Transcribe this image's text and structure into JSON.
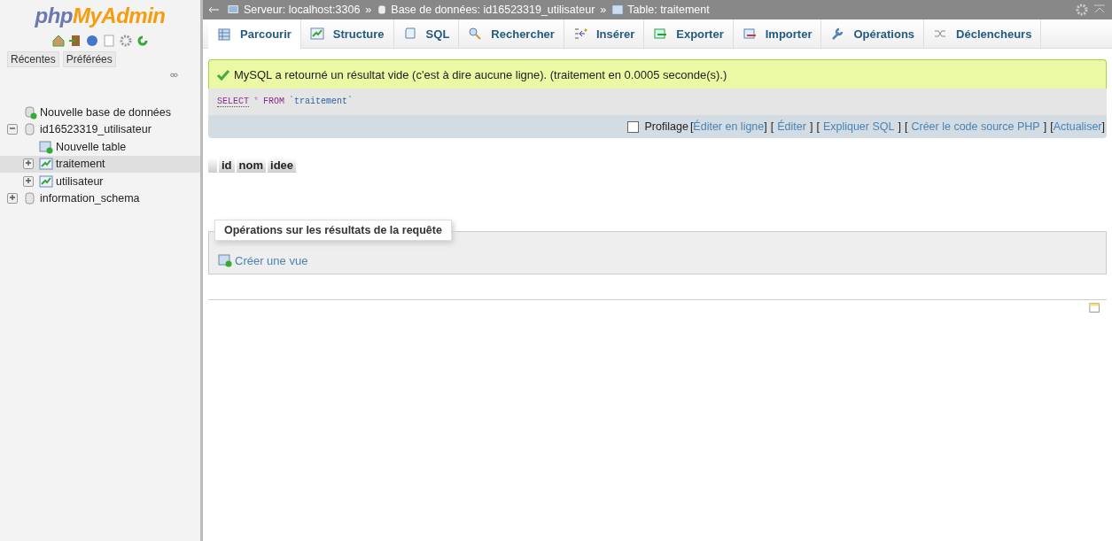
{
  "logo": {
    "part_1": "php",
    "part_2": "MyAdmin"
  },
  "sidebar": {
    "quick_tabs": [
      "Récentes",
      "Préférées"
    ],
    "tree": [
      {
        "kind": "new_db",
        "label": "Nouvelle base de données",
        "selected": false
      },
      {
        "kind": "database",
        "label": "id16523319_utilisateur",
        "expanded": true,
        "selected": false,
        "children": [
          {
            "kind": "new_table",
            "label": "Nouvelle table",
            "selected": false
          },
          {
            "kind": "table",
            "label": "traitement",
            "expanded": false,
            "selected": true
          },
          {
            "kind": "table",
            "label": "utilisateur",
            "expanded": false,
            "selected": false
          }
        ]
      },
      {
        "kind": "database",
        "label": "information_schema",
        "expanded": false,
        "selected": false
      }
    ]
  },
  "breadcrumb": [
    {
      "kind": "server",
      "label": "Serveur: localhost:3306",
      "separator": "»"
    },
    {
      "kind": "database",
      "label": "Base de données: id16523319_utilisateur",
      "separator": "»"
    },
    {
      "kind": "table",
      "label": "Table: traitement"
    }
  ],
  "tabs": [
    {
      "kind": "browse",
      "label": "Parcourir",
      "selected": true
    },
    {
      "kind": "structure",
      "label": "Structure",
      "selected": false
    },
    {
      "kind": "sql",
      "label": "SQL",
      "selected": false
    },
    {
      "kind": "search",
      "label": "Rechercher",
      "selected": false
    },
    {
      "kind": "insert",
      "label": "Insérer",
      "selected": false
    },
    {
      "kind": "export",
      "label": "Exporter",
      "selected": false
    },
    {
      "kind": "import",
      "label": "Importer",
      "selected": false
    },
    {
      "kind": "operations",
      "label": "Opérations",
      "selected": false
    },
    {
      "kind": "triggers",
      "label": "Déclencheurs",
      "selected": false
    }
  ],
  "message": "MySQL a retourné un résultat vide (c'est à dire aucune ligne). (traitement en 0.0005 seconde(s).)",
  "query": [
    {
      "kind": "keyword",
      "text": "SELECT"
    },
    {
      "kind": "operator",
      "text": "*"
    },
    {
      "kind": "keyword",
      "text": "FROM"
    },
    {
      "kind": "name",
      "text": "`traitement`"
    }
  ],
  "profiling": {
    "checked": false,
    "label": "Profilage",
    "links": [
      {
        "open": "[",
        "label": "Éditer en ligne",
        "close": "]"
      },
      {
        "open": "[",
        "label": "Éditer",
        "close": "]"
      },
      {
        "open": "[",
        "label": "Expliquer SQL",
        "close": "]"
      },
      {
        "open": "[",
        "label": "Créer le code source PHP",
        "close": "]"
      },
      {
        "open": "[",
        "label": "Actualiser",
        "close": "]"
      }
    ]
  },
  "table": {
    "columns": [
      "id",
      "nom",
      "idee"
    ]
  },
  "operations": {
    "legend": "Opérations sur les résultats de la requête",
    "action": "Créer une vue"
  }
}
